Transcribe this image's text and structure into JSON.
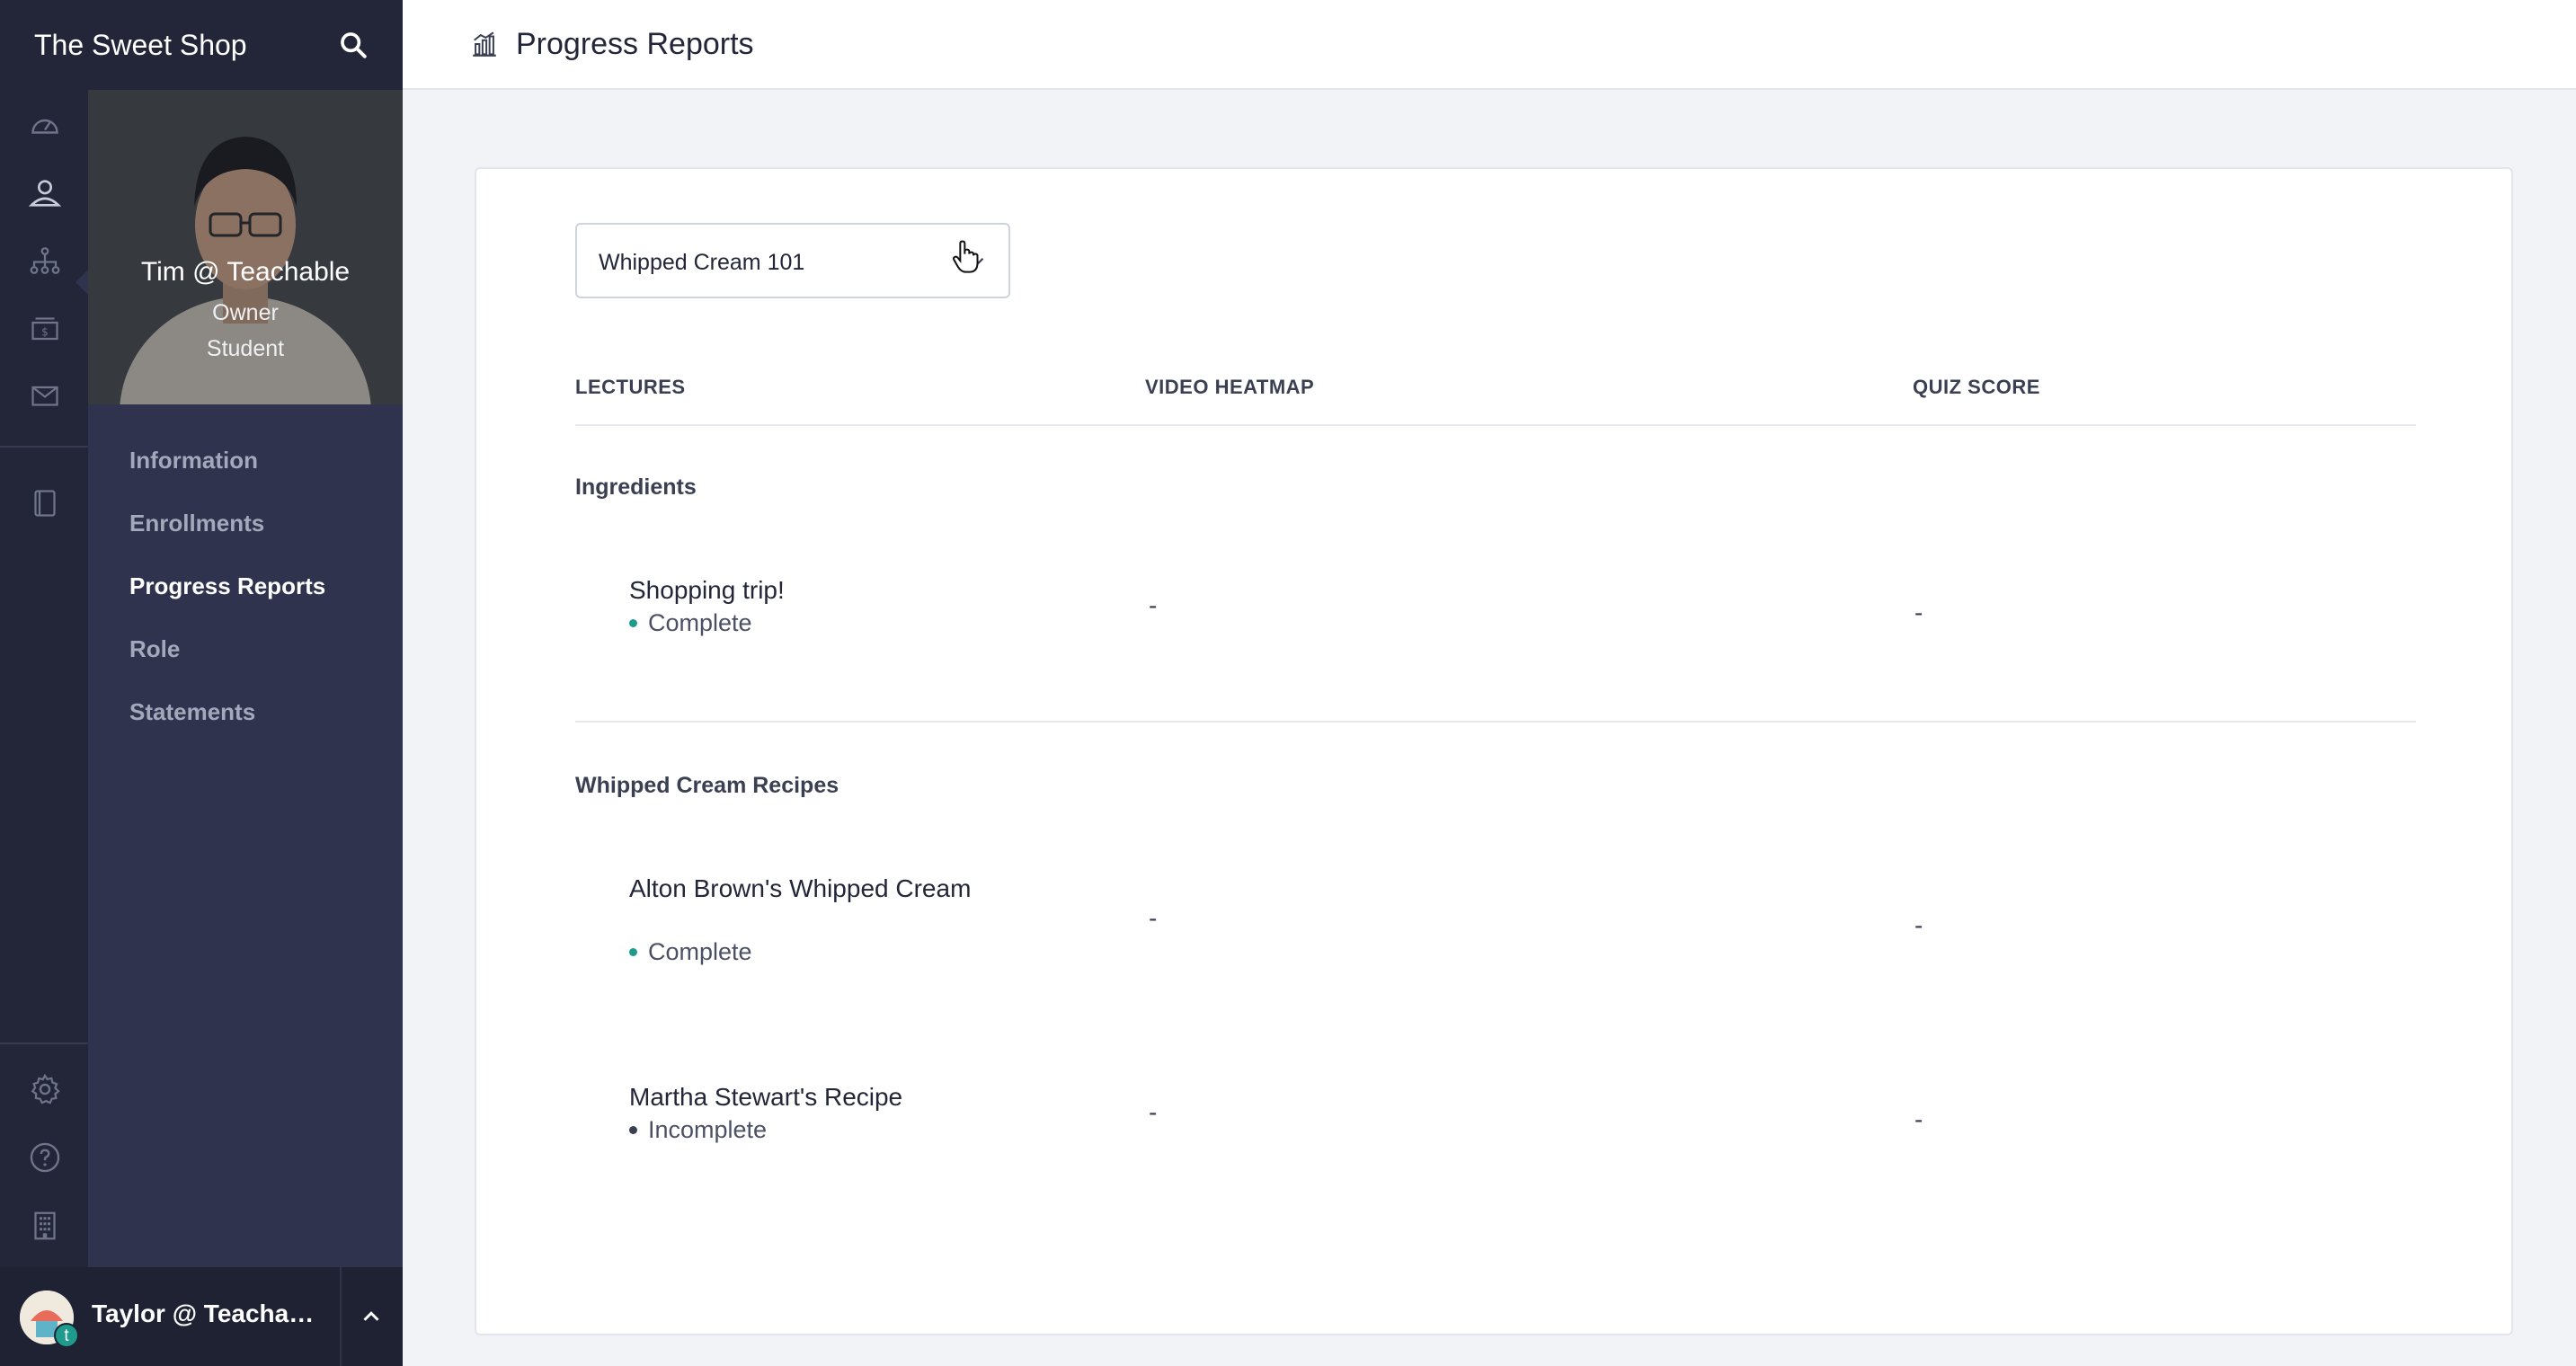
{
  "app": {
    "title": "The Sweet Shop"
  },
  "rail": {
    "icons": [
      "dashboard-icon",
      "users-icon",
      "sitemap-icon",
      "sales-icon",
      "email-icon",
      "book-icon",
      "settings-icon",
      "help-icon",
      "building-icon"
    ]
  },
  "profile": {
    "name": "Tim @ Teachable",
    "roles": [
      "Owner",
      "Student"
    ]
  },
  "sub_nav": {
    "items": [
      {
        "label": "Information",
        "active": false
      },
      {
        "label": "Enrollments",
        "active": false
      },
      {
        "label": "Progress Reports",
        "active": true
      },
      {
        "label": "Role",
        "active": false
      },
      {
        "label": "Statements",
        "active": false
      }
    ]
  },
  "user": {
    "name": "Taylor @ Teachabl...",
    "badge": "t"
  },
  "header": {
    "title": "Progress Reports",
    "icon": "bar-chart-icon"
  },
  "course_select": {
    "value": "Whipped Cream 101"
  },
  "table": {
    "columns": [
      "LECTURES",
      "VIDEO HEATMAP",
      "QUIZ SCORE"
    ],
    "sections": [
      {
        "title": "Ingredients",
        "lectures": [
          {
            "name": "Shopping trip!",
            "status": "Complete",
            "heatmap": "-",
            "quiz": "-"
          }
        ]
      },
      {
        "title": "Whipped Cream Recipes",
        "lectures": [
          {
            "name": "Alton Brown's Whipped Cream",
            "status": "Complete",
            "heatmap": "-",
            "quiz": "-"
          },
          {
            "name": "Martha Stewart's Recipe",
            "status": "Incomplete",
            "heatmap": "-",
            "quiz": "-"
          }
        ]
      }
    ]
  },
  "colors": {
    "sidebar_dark": "#222638",
    "sidebar_mid": "#2f334d",
    "complete_dot": "#1f9b8e",
    "incomplete_dot": "#3a4052"
  }
}
